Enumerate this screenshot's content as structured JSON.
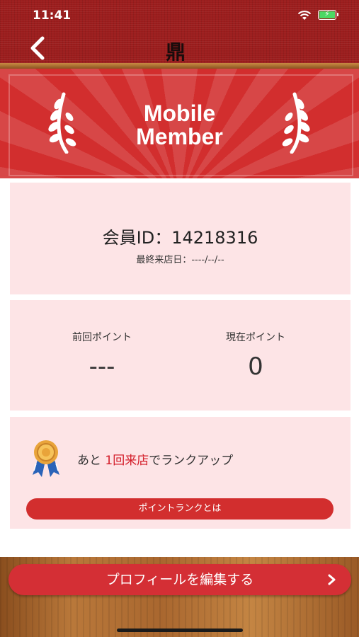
{
  "status_bar": {
    "time": "11:41"
  },
  "header": {
    "logo_text": "鼎"
  },
  "banner": {
    "title_line1": "Mobile",
    "title_line2": "Member"
  },
  "member": {
    "id_text": "会員ID：14218316",
    "last_visit_text": "最終来店日：----/--/--"
  },
  "points": {
    "previous_label": "前回ポイント",
    "previous_value": "---",
    "current_label": "現在ポイント",
    "current_value": "0"
  },
  "rank": {
    "prefix": "あと",
    "highlight": "1回来店",
    "suffix": "でランクアップ",
    "highlight_color": "#d41e2a",
    "button_label": "ポイントランクとは"
  },
  "footer": {
    "profile_button_label": "プロフィールを編集する"
  },
  "colors": {
    "header": "#9c1d1d",
    "banner": "#d22e2e",
    "card": "#fde4e6",
    "button": "#d42f35"
  }
}
